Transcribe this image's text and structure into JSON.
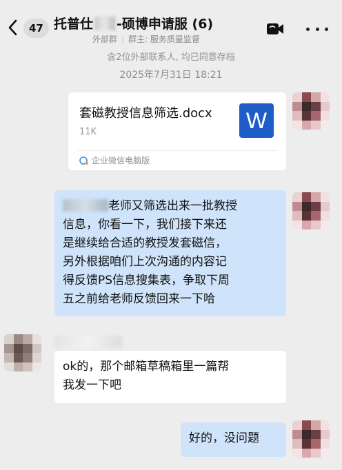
{
  "header": {
    "back_icon": "chevron-left-icon",
    "unread_count": "47",
    "title_prefix": "托普仕",
    "title_suffix": "-硕博申请服 (6)",
    "external_tag": "外部群",
    "owner_label": "群主: 服务质量监督",
    "video_icon": "video-call-icon",
    "more_icon": "more-icon"
  },
  "system": {
    "external_notice": "含2位外部联系人, 均已同意存档",
    "timestamp": "2025年7月31日 18:21"
  },
  "messages": {
    "file": {
      "name": "套磁教授信息筛选.docx",
      "size": "11K",
      "icon_letter": "W",
      "source": "企业微信电脑版"
    },
    "my_message_1": {
      "line1_text": "老师又筛选出来一批教授",
      "line2": "信息，你看一下，我们接下来还",
      "line3": "是继续给合适的教授发套磁信，",
      "line4": "另外根据咱们上次沟通的内容记",
      "line5": "得反馈PS信息搜集表，争取下周",
      "line6": "五之前给老师反馈回来一下哈"
    },
    "their_message": {
      "line1": "ok的，那个邮箱草稿箱里一篇帮",
      "line2": "我发一下吧"
    },
    "my_message_2": {
      "text": "好的，没问题"
    }
  },
  "colors": {
    "background": "#ededed",
    "my_bubble": "#cfe4fa",
    "their_bubble": "#ffffff",
    "word_blue": "#1e5cc8"
  }
}
